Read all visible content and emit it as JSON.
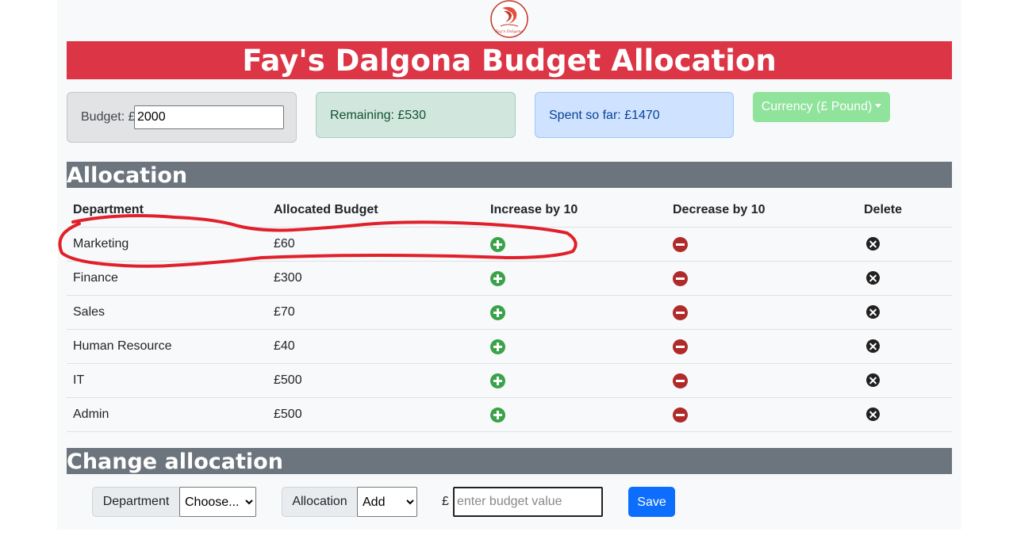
{
  "header": {
    "logo_text": "Fay's Dalgona",
    "title": "Fay's Dalgona Budget Allocation"
  },
  "summary": {
    "budget_label": "Budget: £",
    "budget_value": "2000",
    "remaining_text": "Remaining: £530",
    "spent_text": "Spent so far: £1470",
    "currency_button": "Currency (£ Pound)"
  },
  "allocation": {
    "section_title": "Allocation",
    "columns": [
      "Department",
      "Allocated Budget",
      "Increase by 10",
      "Decrease by 10",
      "Delete"
    ],
    "rows": [
      {
        "department": "Marketing",
        "budget": "£60"
      },
      {
        "department": "Finance",
        "budget": "£300"
      },
      {
        "department": "Sales",
        "budget": "£70"
      },
      {
        "department": "Human Resource",
        "budget": "£40"
      },
      {
        "department": "IT",
        "budget": "£500"
      },
      {
        "department": "Admin",
        "budget": "£500"
      }
    ]
  },
  "change": {
    "section_title": "Change allocation",
    "department_label": "Department",
    "department_selected": "Choose...",
    "allocation_label": "Allocation",
    "allocation_selected": "Add",
    "currency_symbol": "£",
    "value_placeholder": "enter budget value",
    "save_label": "Save"
  },
  "colors": {
    "title_bar": "#dc3545",
    "section_bar": "#6c757d",
    "increase_icon": "#3aa34a",
    "decrease_icon": "#b02a2a",
    "delete_icon": "#222222",
    "annotation": "#e0202a",
    "save_button": "#0d6efd"
  },
  "icons": {
    "increase": "plus-circle-icon",
    "decrease": "minus-circle-icon",
    "delete": "x-circle-icon"
  }
}
